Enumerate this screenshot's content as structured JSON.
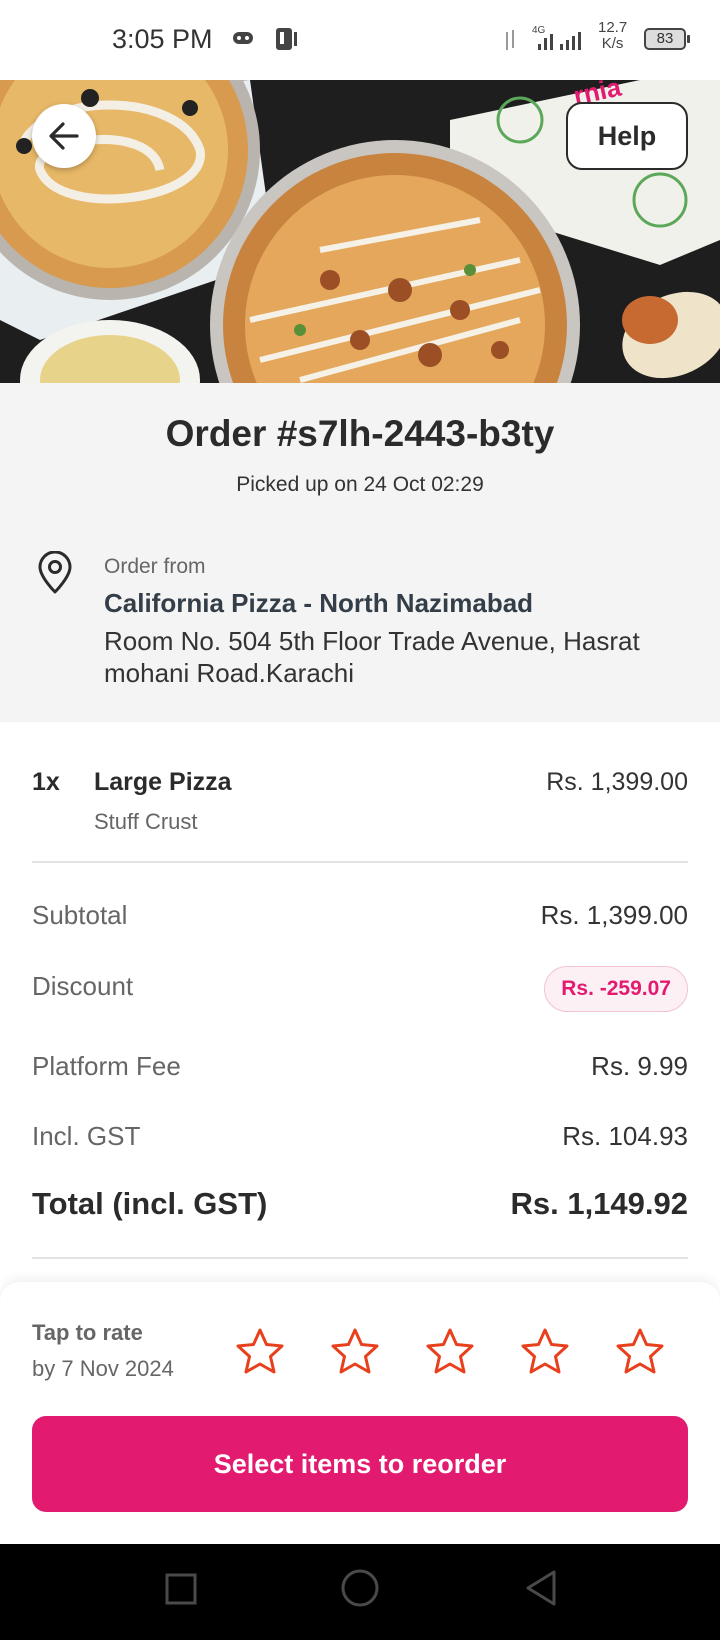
{
  "status_bar": {
    "time": "3:05 PM",
    "network_type": "4G",
    "speed_value": "12.7",
    "speed_unit": "K/s",
    "battery": "83"
  },
  "header": {
    "help_label": "Help"
  },
  "order": {
    "title": "Order #s7lh-2443-b3ty",
    "status": "Picked up on 24 Oct 02:29",
    "from_label": "Order from",
    "restaurant": "California Pizza - North Nazimabad",
    "address": "Room No. 504 5th Floor Trade Avenue, Hasrat mohani Road.Karachi"
  },
  "items": [
    {
      "qty": "1x",
      "name": "Large Pizza",
      "option": "Stuff Crust",
      "price": "Rs. 1,399.00"
    }
  ],
  "summary": {
    "subtotal_label": "Subtotal",
    "subtotal_value": "Rs. 1,399.00",
    "discount_label": "Discount",
    "discount_value": "Rs. -259.07",
    "platform_fee_label": "Platform Fee",
    "platform_fee_value": "Rs. 9.99",
    "gst_label": "Incl. GST",
    "gst_value": "Rs. 104.93",
    "total_label": "Total (incl. GST)",
    "total_value": "Rs. 1,149.92"
  },
  "rating": {
    "title": "Tap to rate",
    "deadline": "by 7 Nov 2024",
    "stars": 5
  },
  "actions": {
    "reorder_label": "Select items to reorder"
  },
  "colors": {
    "brand_pink": "#e21b70",
    "star_orange": "#e8401c",
    "text_dark": "#2b2b2b"
  },
  "icons": {
    "back": "arrow-left-icon",
    "location": "map-pin-icon",
    "star": "star-outline-icon",
    "nav_recents": "square-icon",
    "nav_home": "circle-icon",
    "nav_back": "triangle-back-icon"
  }
}
